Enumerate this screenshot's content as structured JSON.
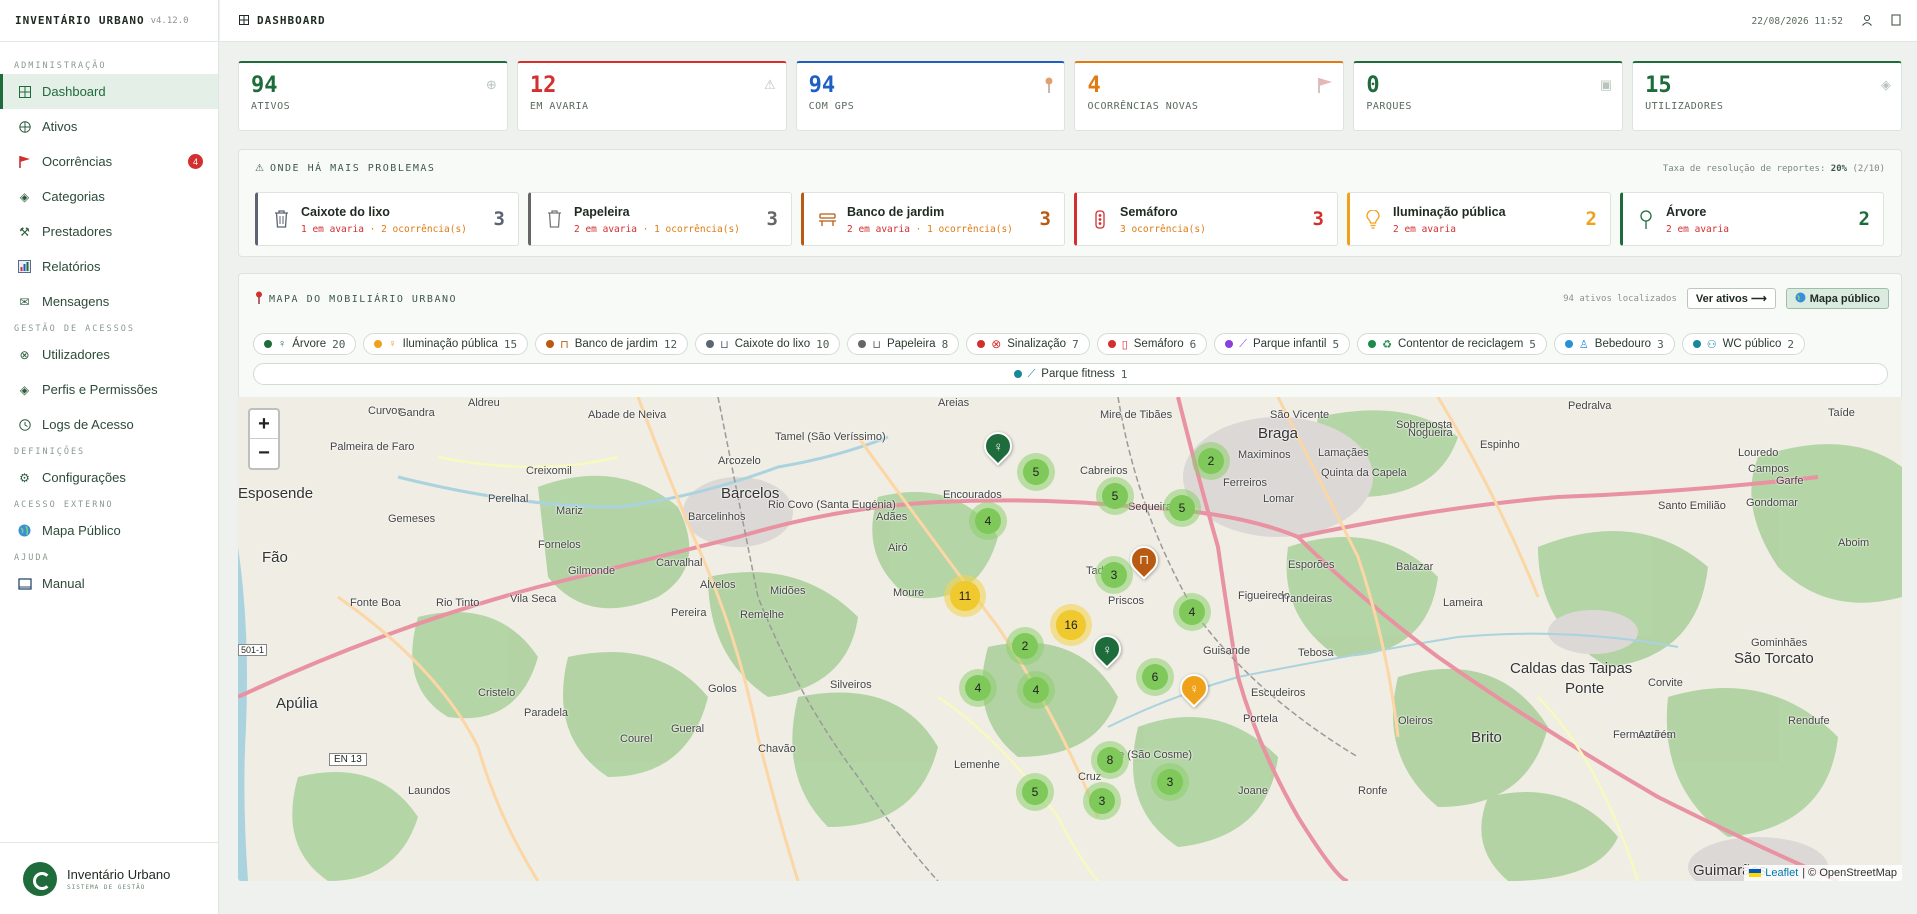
{
  "app": {
    "name": "INVENTÁRIO URBANO",
    "version": "v4.12.0"
  },
  "sidebar": {
    "sections": [
      {
        "label": "ADMINISTRAÇÃO",
        "items": [
          {
            "label": "Dashboard",
            "icon": "grid-icon"
          },
          {
            "label": "Ativos",
            "icon": "globe-icon"
          },
          {
            "label": "Ocorrências",
            "icon": "flag-icon",
            "badge": "4"
          },
          {
            "label": "Categorias",
            "icon": "diamond-icon"
          },
          {
            "label": "Prestadores",
            "icon": "tools-icon"
          },
          {
            "label": "Relatórios",
            "icon": "bar-chart-icon"
          },
          {
            "label": "Mensagens",
            "icon": "mail-icon"
          }
        ]
      },
      {
        "label": "GESTÃO DE ACESSOS",
        "items": [
          {
            "label": "Utilizadores",
            "icon": "users-icon"
          },
          {
            "label": "Perfis e Permissões",
            "icon": "diamond-icon"
          },
          {
            "label": "Logs de Acesso",
            "icon": "clock-icon"
          }
        ]
      },
      {
        "label": "DEFINIÇÕES",
        "items": [
          {
            "label": "Configurações",
            "icon": "gear-icon"
          }
        ]
      },
      {
        "label": "ACESSO EXTERNO",
        "items": [
          {
            "label": "Mapa Público",
            "icon": "globe-icon"
          }
        ]
      },
      {
        "label": "AJUDA",
        "items": [
          {
            "label": "Manual",
            "icon": "book-icon"
          }
        ]
      }
    ],
    "footer": {
      "title": "Inventário Urbano",
      "subtitle": "SISTEMA DE GESTÃO"
    }
  },
  "topbar": {
    "title": "DASHBOARD",
    "datetime": "22/08/2026 11:52"
  },
  "stats": [
    {
      "value": "94",
      "label": "ATIVOS",
      "color": "#1e6b3b"
    },
    {
      "value": "12",
      "label": "EM AVARIA",
      "color": "#d32f2f"
    },
    {
      "value": "94",
      "label": "COM GPS",
      "color": "#1f5fc4"
    },
    {
      "value": "4",
      "label": "OCORRÊNCIAS NOVAS",
      "color": "#e07a12"
    },
    {
      "value": "0",
      "label": "PARQUES",
      "color": "#1e6b3b"
    },
    {
      "value": "15",
      "label": "UTILIZADORES",
      "color": "#1e6b3b"
    }
  ],
  "problems": {
    "title": "ONDE HÁ MAIS PROBLEMAS",
    "rate_label": "Taxa de resolução de reportes:",
    "rate_value": "20%",
    "rate_detail": "(2/10)",
    "items": [
      {
        "name": "Caixote do lixo",
        "detail_a": "1 em avaria",
        "detail_b": "· 2 ocorrência(s)",
        "count": "3",
        "color": "#5a6472"
      },
      {
        "name": "Papeleira",
        "detail_a": "2 em avaria",
        "detail_b": "· 1 ocorrência(s)",
        "count": "3",
        "color": "#666666"
      },
      {
        "name": "Banco de jardim",
        "detail_a": "2 em avaria",
        "detail_b": "· 1 ocorrência(s)",
        "count": "3",
        "color": "#b85a12"
      },
      {
        "name": "Semáforo",
        "detail_a": "3 ocorrência(s)",
        "detail_b": "",
        "count": "3",
        "color": "#d32f2f"
      },
      {
        "name": "Iluminação pública",
        "detail_a": "2 em avaria",
        "detail_b": "",
        "count": "2",
        "color": "#f0a11a"
      },
      {
        "name": "Árvore",
        "detail_a": "2 em avaria",
        "detail_b": "",
        "count": "2",
        "color": "#1e6b3b"
      }
    ]
  },
  "map": {
    "title": "MAPA DO MOBILIÁRIO URBANO",
    "located": "94 ativos localizados",
    "btn_assets": "Ver ativos ⟶",
    "btn_public": "Mapa público",
    "chips": [
      {
        "label": "Árvore",
        "count": "20",
        "color": "#1e6b3b",
        "icon": "tree-icon"
      },
      {
        "label": "Iluminação pública",
        "count": "15",
        "color": "#f0a11a",
        "icon": "lightbulb-icon"
      },
      {
        "label": "Banco de jardim",
        "count": "12",
        "color": "#b85a12",
        "icon": "bench-icon"
      },
      {
        "label": "Caixote do lixo",
        "count": "10",
        "color": "#5a6472",
        "icon": "trash-icon"
      },
      {
        "label": "Papeleira",
        "count": "8",
        "color": "#666666",
        "icon": "bin-icon"
      },
      {
        "label": "Sinalização",
        "count": "7",
        "color": "#d32f2f",
        "icon": "sign-icon"
      },
      {
        "label": "Semáforo",
        "count": "6",
        "color": "#d32f2f",
        "icon": "traffic-light-icon"
      },
      {
        "label": "Parque infantil",
        "count": "5",
        "color": "#8a3fe0",
        "icon": "slide-icon"
      },
      {
        "label": "Contentor de reciclagem",
        "count": "5",
        "color": "#1e8a4a",
        "icon": "recycle-icon"
      },
      {
        "label": "Bebedouro",
        "count": "3",
        "color": "#2a8fd6",
        "icon": "fountain-icon"
      },
      {
        "label": "WC público",
        "count": "2",
        "color": "#17879a",
        "icon": "wc-icon"
      },
      {
        "label": "Parque fitness",
        "count": "1",
        "color": "#17879a",
        "icon": "fitness-icon"
      }
    ],
    "clusters": [
      "5",
      "2",
      "5",
      "5",
      "4",
      "3",
      "11",
      "16",
      "4",
      "2",
      "6",
      "4",
      "4",
      "8",
      "3",
      "5",
      "3"
    ],
    "labels": [
      "Barcelos",
      "Braga",
      "Fão",
      "Apúlia",
      "Barcelinhos",
      "Guimarães",
      "Caldas das Taipas",
      "São Torcato",
      "Brito",
      "Ponte",
      "Tadim",
      "Cabreiros",
      "Maximinos",
      "Quinta da Capela",
      "Sequeira",
      "Esposende",
      "Arcozelo",
      "Creixomil",
      "Perelhal",
      "Gemeses",
      "Fonte Boa",
      "Rio Tinto",
      "Vila Seca",
      "Cristelo",
      "Paradela",
      "Gilmonde",
      "Carvalhal",
      "Alvelos",
      "Midões",
      "Pereira",
      "Remelhe",
      "Moure",
      "Airó",
      "Adães",
      "Encourados",
      "Mire de Tibães",
      "São Vicente",
      "Nogueira",
      "Lomar",
      "Figueiredo",
      "Tebosa",
      "Escudeiros",
      "Oleiros",
      "Portela",
      "Gondomar",
      "Sobreposta",
      "Pedralva",
      "Espinho",
      "Esporões",
      "Balazar",
      "Trandeiras",
      "Priscos",
      "Guisande",
      "Lamaçães",
      "Ferreiros",
      "Curvos",
      "Abade de Neiva",
      "Areias",
      "Aldreu",
      "Palmeira de Faro",
      "Mariz",
      "Fornelos",
      "Courel",
      "Chavão",
      "Gueral",
      "Golos",
      "Silveiros",
      "Lemenhe",
      "Laundos",
      "Gandra",
      "Rio Covo (Santa Eugénia)",
      "Tamel (São Veríssimo)",
      "Vale (São Cosme)",
      "Cruz",
      "Joane",
      "Ronfe",
      "Fermentões",
      "Azurém",
      "Corvite",
      "Gominhães",
      "Rendufe",
      "Campos",
      "Garfe",
      "Taíde",
      "Louredo",
      "Santo Emilião",
      "Aboim",
      "Lameira"
    ],
    "attribution_leaflet": "Leaflet",
    "attribution_osm": "| © OpenStreetMap",
    "road_label": "EN 13",
    "road_label2": "501-1"
  }
}
